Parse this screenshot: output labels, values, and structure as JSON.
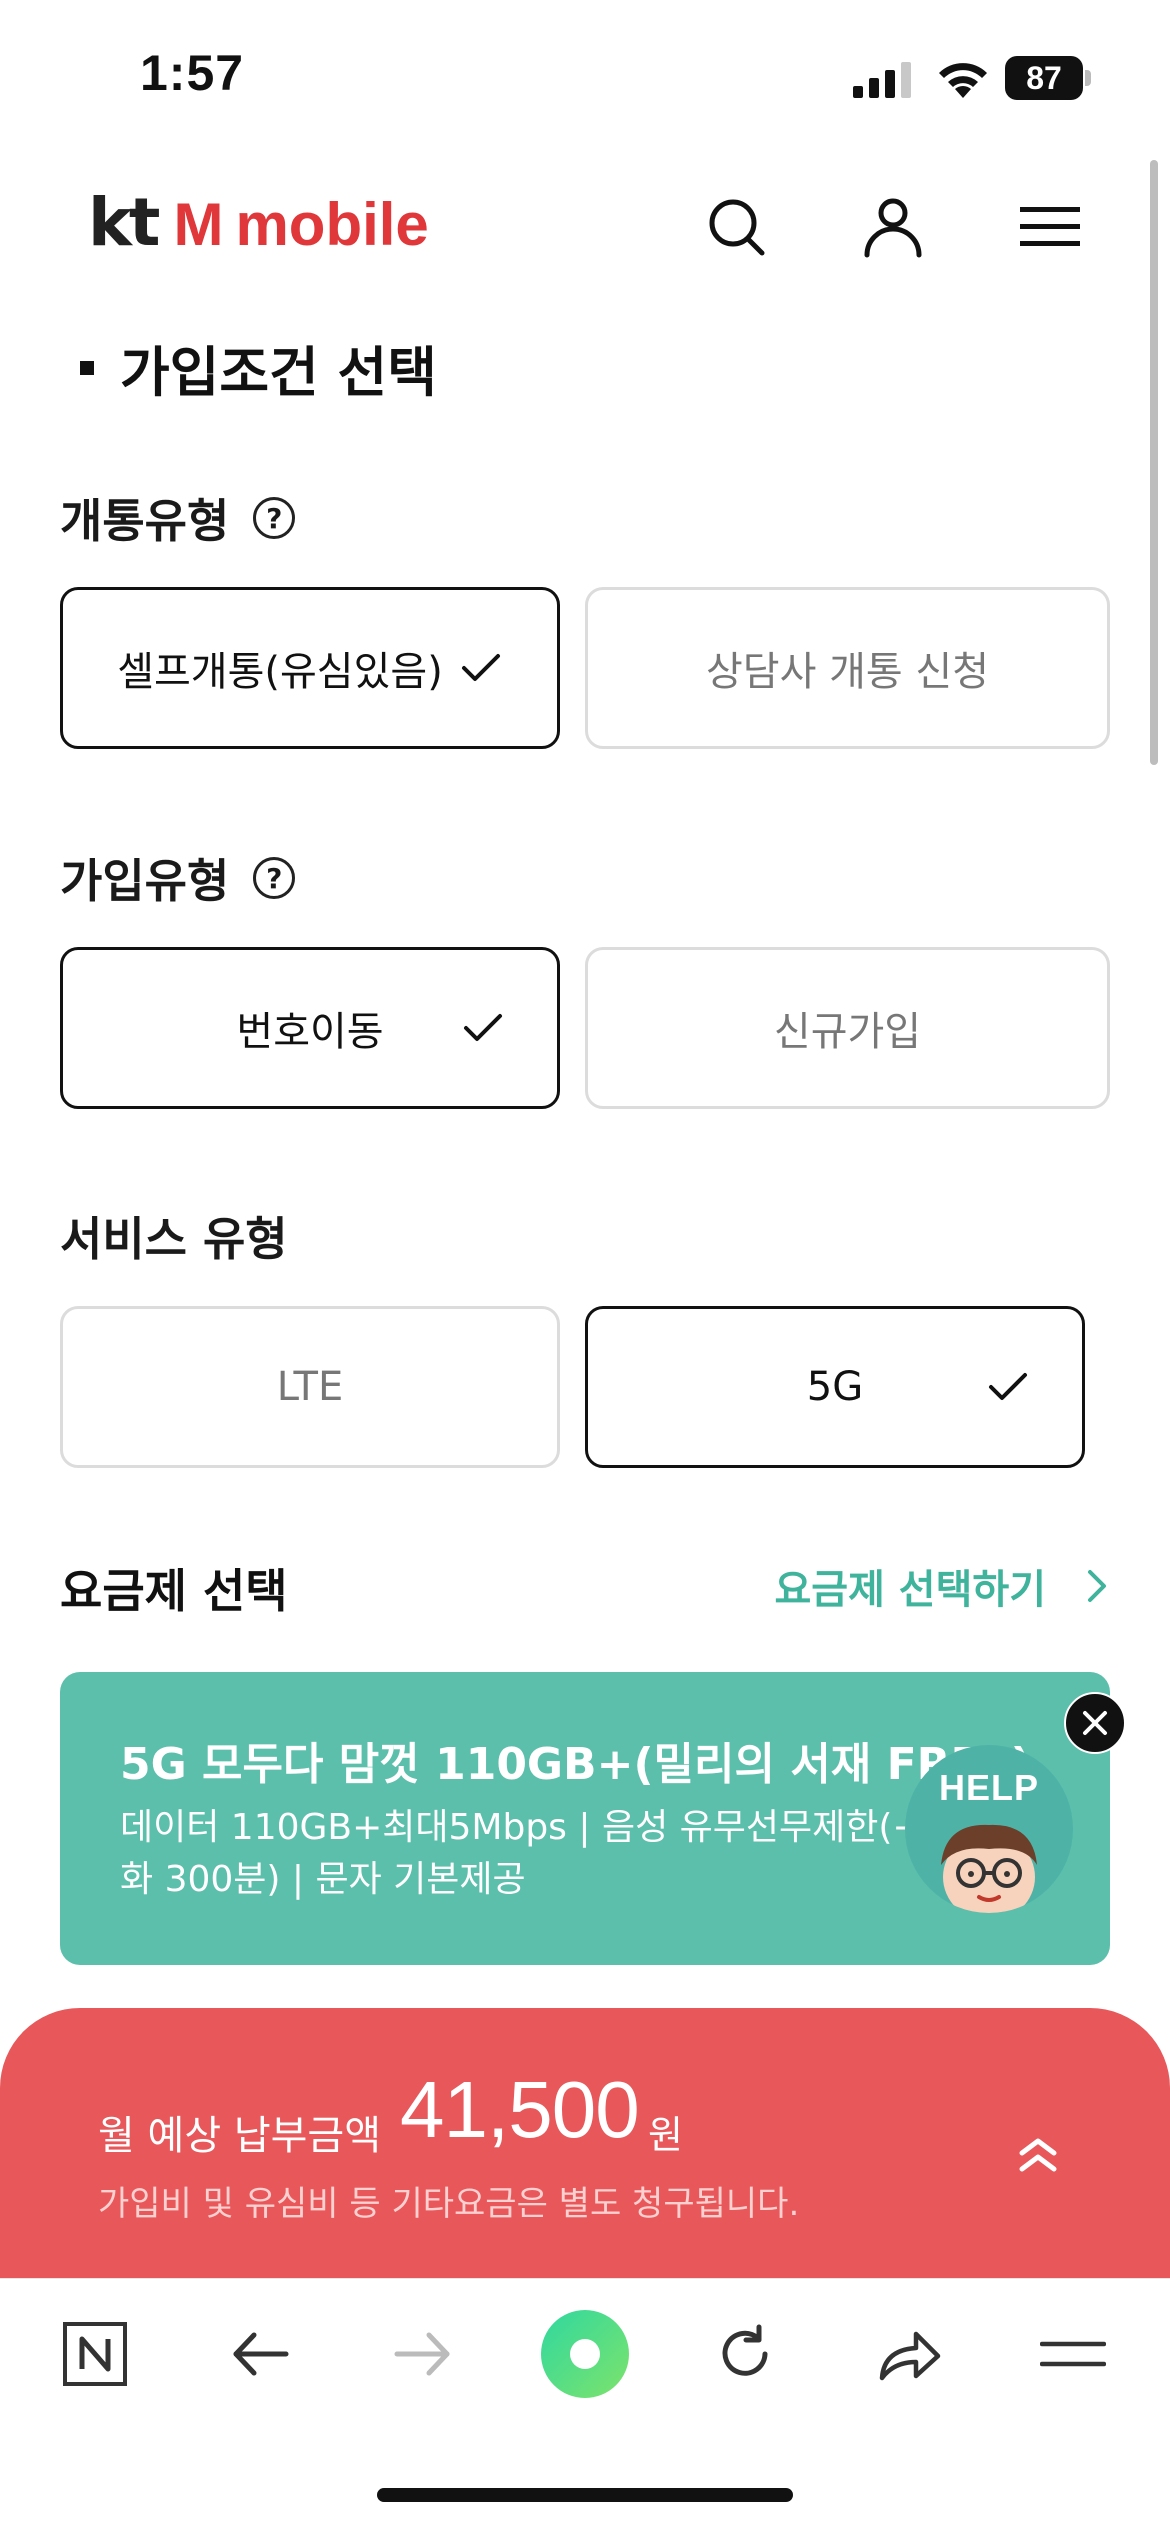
{
  "status_bar": {
    "time": "1:57",
    "battery": "87"
  },
  "header": {
    "logo_kt": "kt",
    "logo_m": "M",
    "logo_mobile": "mobile"
  },
  "page": {
    "title": "가입조건 선택"
  },
  "activation": {
    "label": "개통유형",
    "options": [
      {
        "label": "셀프개통(유심있음)",
        "selected": true
      },
      {
        "label": "상담사 개통 신청",
        "selected": false
      }
    ]
  },
  "subscription": {
    "label": "가입유형",
    "options": [
      {
        "label": "번호이동",
        "selected": true
      },
      {
        "label": "신규가입",
        "selected": false
      }
    ]
  },
  "service": {
    "label": "서비스 유형",
    "options": [
      {
        "label": "LTE",
        "selected": false
      },
      {
        "label": "5G",
        "selected": true
      }
    ]
  },
  "plan": {
    "label": "요금제 선택",
    "link": "요금제 선택하기",
    "name": "5G 모두다 맘껏 110GB+(밀리의 서재 FREE)",
    "description": "데이터 110GB+최대5Mbps | 음성 유무선무제한(+영상통화 300분) | 문자 기본제공"
  },
  "help_bot": {
    "label": "HELP"
  },
  "price": {
    "label": "월 예상 납부금액",
    "value": "41,500",
    "unit": "원",
    "note": "가입비 및 유심비 등 기타요금은 별도 청구됩니다."
  },
  "toolbar": {
    "n_label": "N"
  },
  "colors": {
    "brand_red": "#e0373a",
    "teal": "#5bbfab",
    "price_red": "#e8575a"
  }
}
